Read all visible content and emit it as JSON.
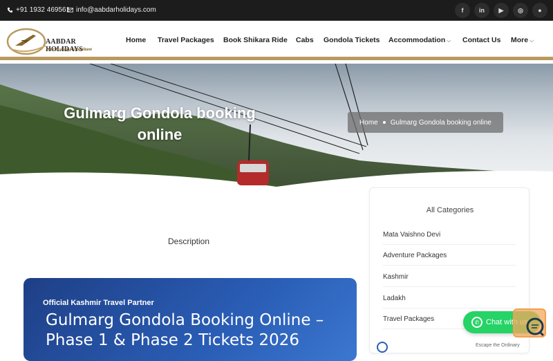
{
  "topbar": {
    "phone": "+91 1932 469561",
    "email": "info@aabdarholidays.com",
    "social": [
      {
        "icon": "facebook-icon",
        "glyph": "f"
      },
      {
        "icon": "linkedin-icon",
        "glyph": "in"
      },
      {
        "icon": "youtube-icon",
        "glyph": "▶"
      },
      {
        "icon": "instagram-icon",
        "glyph": "◎"
      },
      {
        "icon": "reddit-icon",
        "glyph": "●"
      }
    ]
  },
  "header": {
    "brand": "AABDAR HOLIDAYS",
    "tagline": "Your Holiday Consultant",
    "nav": [
      "Home",
      "Travel Packages",
      "Book Shikara Ride",
      "Cabs",
      "Gondola Tickets",
      "Accommodation",
      "Contact Us",
      "More"
    ]
  },
  "hero": {
    "title": "Gulmarg Gondola booking online",
    "breadcrumb_home": "Home",
    "breadcrumb_current": "Gulmarg Gondola booking online"
  },
  "content": {
    "tab": "Description",
    "kicker": "Official Kashmir Travel Partner",
    "heading": "Gulmarg Gondola Booking Online – Phase 1 & Phase 2 Tickets 2026"
  },
  "sidebar": {
    "heading": "All Categories",
    "categories": [
      "Mata Vaishno Devi",
      "Adventure Packages",
      "Kashmir",
      "Ladakh",
      "Travel Packages"
    ],
    "footer_text": "Escape the Ordinary"
  },
  "chat": {
    "label": "Chat with us"
  },
  "colors": {
    "accent": "#b8995f",
    "promo": "#2a5db5",
    "whatsapp": "#25d366",
    "topbar": "#1c1c1c"
  }
}
